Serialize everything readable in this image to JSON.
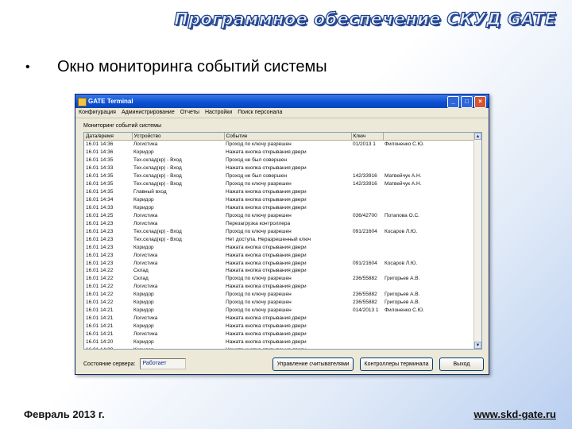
{
  "slide": {
    "header_title": "Программное обеспечение СКУД GATE",
    "bullet": "•",
    "heading": "Окно мониторинга событий системы",
    "footer_date": "Февраль 2013 г.",
    "footer_url": "www.skd-gate.ru"
  },
  "window": {
    "title": "GATE Terminal",
    "menu": [
      "Конфигурация",
      "Администрирование",
      "Отчеты",
      "Настройки",
      "Поиск персонала"
    ],
    "panel_label": "Мониторинг событий системы",
    "columns": [
      "Дата/время",
      "Устройство",
      "Событие",
      "Ключ",
      ""
    ],
    "rows": [
      [
        "16.01 14:36",
        "Логистика",
        "Проход по ключу разрешен",
        "01/2013 1",
        "Филоненко С.Ю."
      ],
      [
        "16.01 14:36",
        "Коридор",
        "Нажата кнопка открывания двери",
        "",
        ""
      ],
      [
        "16.01 14:35",
        "Тех.склад(кр) - Вход",
        "Проход не был совершен",
        "",
        ""
      ],
      [
        "16.01 14:33",
        "Тех.склад(кр) - Вход",
        "Нажата кнопка открывания двери",
        "",
        ""
      ],
      [
        "16.01 14:35",
        "Тех.склад(кр) - Вход",
        "Проход не был совершен",
        "142/33916",
        "Матвейчук А.Н."
      ],
      [
        "16.01 14:35",
        "Тех.склад(кр) - Вход",
        "Проход по ключу разрешен",
        "142/33916",
        "Матвейчук А.Н."
      ],
      [
        "16.01 14:35",
        "Главный вход",
        "Нажата кнопка открывания двери",
        "",
        ""
      ],
      [
        "16.01 14:34",
        "Коридор",
        "Нажата кнопка открывания двери",
        "",
        ""
      ],
      [
        "16.01 14:33",
        "Коридор",
        "Нажата кнопка открывания двери",
        "",
        ""
      ],
      [
        "16.01 14:25",
        "Логистика",
        "Проход по ключу разрешен",
        "036/42700",
        "Потапова О.С."
      ],
      [
        "16.01 14:23",
        "Логистика",
        "Перезагрузка контроллера",
        "",
        ""
      ],
      [
        "16.01 14:23",
        "Тех.склад(кр) - Вход",
        "Проход по ключу разрешен",
        "091/21604",
        "Косаров Л.Ю."
      ],
      [
        "16.01 14:23",
        "Тех.склад(кр) - Вход",
        "Нет доступа. Неразрешенный ключ",
        "",
        ""
      ],
      [
        "16.01 14:23",
        "Коридор",
        "Нажата кнопка открывания двери",
        "",
        ""
      ],
      [
        "16.01 14:23",
        "Логистика",
        "Нажата кнопка открывания двери",
        "",
        ""
      ],
      [
        "16.01 14:23",
        "Логистика",
        "Нажата кнопка открывания двери",
        "091/21604",
        "Косаров Л.Ю."
      ],
      [
        "16.01 14:22",
        "Склад",
        "Нажата кнопка открывания двери",
        "",
        ""
      ],
      [
        "16.01 14:22",
        "Склад",
        "Проход по ключу разрешен",
        "236/55882",
        "Григорьев А.В."
      ],
      [
        "16.01 14:22",
        "Логистика",
        "Нажата кнопка открывания двери",
        "",
        ""
      ],
      [
        "16.01 14:22",
        "Коридор",
        "Проход по ключу разрешен",
        "236/55882",
        "Григорьев А.В."
      ],
      [
        "16.01 14:22",
        "Коридор",
        "Проход по ключу разрешен",
        "236/55882",
        "Григорьев А.В."
      ],
      [
        "16.01 14:21",
        "Коридор",
        "Проход по ключу разрешен",
        "014/2013 1",
        "Филоненко С.Ю."
      ],
      [
        "16.01 14:21",
        "Логистика",
        "Нажата кнопка открывания двери",
        "",
        ""
      ],
      [
        "16.01 14:21",
        "Коридор",
        "Нажата кнопка открывания двери",
        "",
        ""
      ],
      [
        "16.01 14:21",
        "Логистика",
        "Нажата кнопка открывания двери",
        "",
        ""
      ],
      [
        "16.01 14:20",
        "Коридор",
        "Нажата кнопка открывания двери",
        "",
        ""
      ],
      [
        "16.01 14:20",
        "Коридор",
        "Нажата кнопка открывания двери",
        "",
        ""
      ]
    ],
    "status_label": "Состояние сервера:",
    "status_value": "Работает",
    "buttons": [
      "Управление считывателями",
      "Контроллеры терминала",
      "Выход"
    ]
  }
}
